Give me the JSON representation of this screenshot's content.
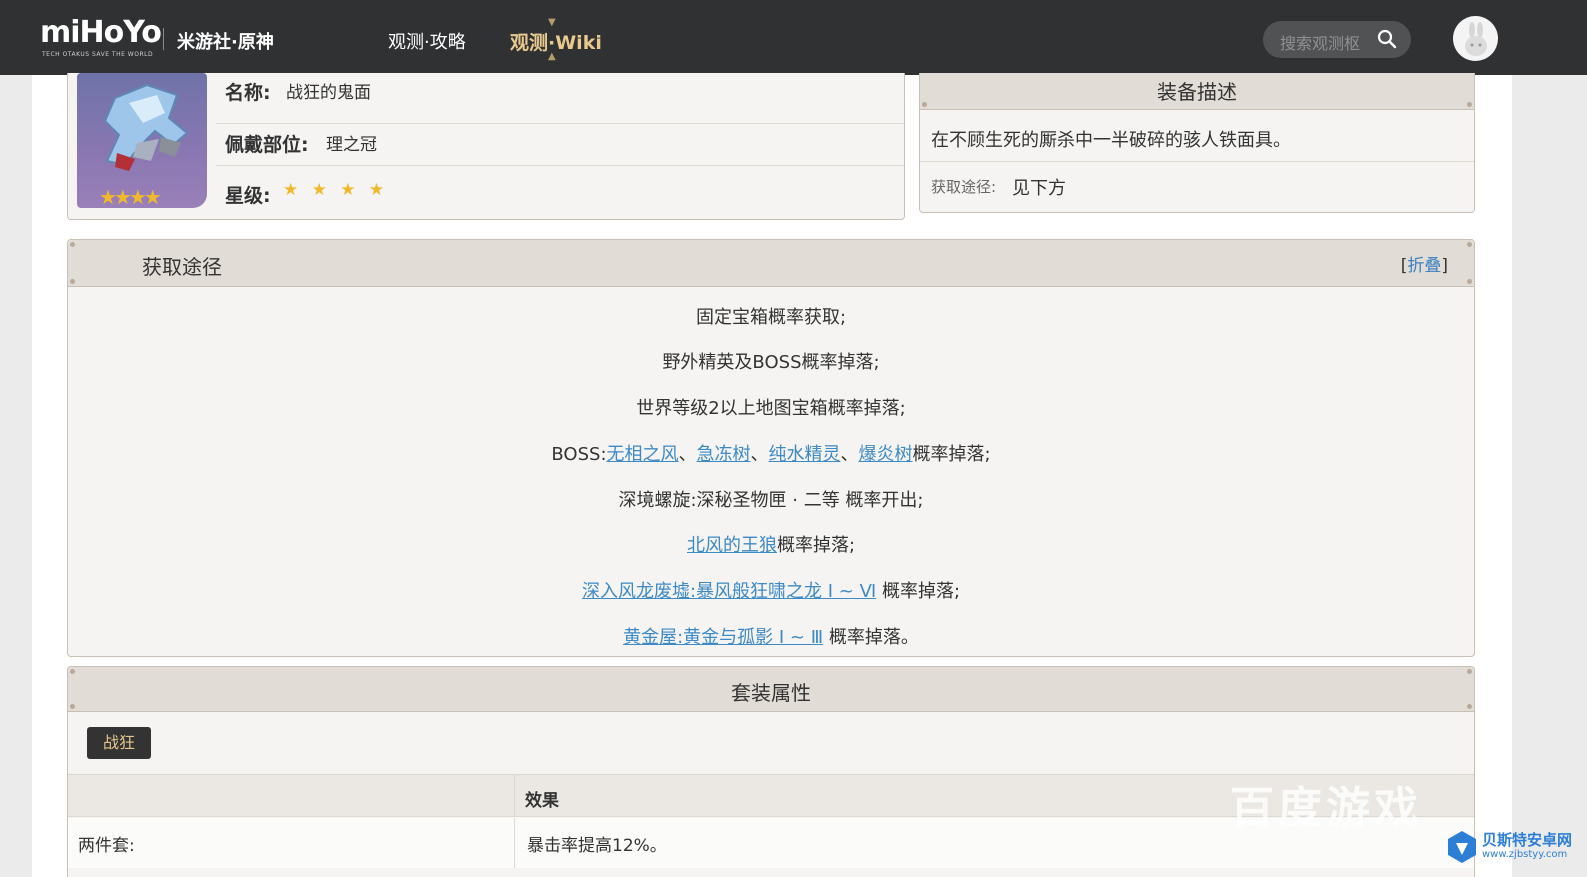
{
  "header": {
    "logo": "miHoYo",
    "logo_sub": "TECH OTAKUS SAVE THE WORLD",
    "brand": "米游社·原神",
    "nav": [
      "观测·攻略",
      "观测·Wiki"
    ],
    "search_placeholder": "搜索观测枢"
  },
  "item": {
    "name_label": "名称:",
    "name": "战狂的鬼面",
    "slot_label": "佩戴部位:",
    "slot": "理之冠",
    "rarity_label": "星级:",
    "rarity_stars": "★ ★ ★ ★",
    "thumb_stars": "★★★★",
    "rarity": 4
  },
  "description": {
    "title": "装备描述",
    "text": "在不顾生死的厮杀中一半破碎的骇人铁面具。",
    "source_label": "获取途径:",
    "source_value": "见下方"
  },
  "obtain": {
    "title": "获取途径",
    "fold_open": "[",
    "fold": "折叠",
    "fold_close": "]",
    "l1": "固定宝箱概率获取;",
    "l2": "野外精英及BOSS概率掉落;",
    "l3": "世界等级2以上地图宝箱概率掉落;",
    "l4_prefix": "BOSS:",
    "l4_links": [
      "无相之风",
      "急冻树",
      "纯水精灵",
      "爆炎树"
    ],
    "l4_sep": "、",
    "l4_suffix": "概率掉落;",
    "l5": "深境螺旋:深秘圣物匣 · 二等 概率开出;",
    "l6_link": "北风的王狼",
    "l6_suffix": "概率掉落;",
    "l7_link": "深入风龙废墟:暴风般狂啸之龙 Ⅰ ~ Ⅵ",
    "l7_suffix": " 概率掉落;",
    "l8_link": "黄金屋:黄金与孤影 Ⅰ ~ Ⅲ",
    "l8_suffix": " 概率掉落。"
  },
  "set": {
    "title": "套装属性",
    "tag": "战狂",
    "col_effect": "效果",
    "row1_label": "两件套:",
    "row1_effect": "暴击率提高12%。"
  },
  "watermark": {
    "text": "百度游戏",
    "site_name": "贝斯特安卓网",
    "site_url": "www.zjbstyy.com"
  },
  "colors": {
    "topbar": "#2f3133",
    "accent_gold": "#e9c98e",
    "link": "#3d8ac6",
    "star": "#f1b82c",
    "card_head": "#e1dcd5"
  }
}
